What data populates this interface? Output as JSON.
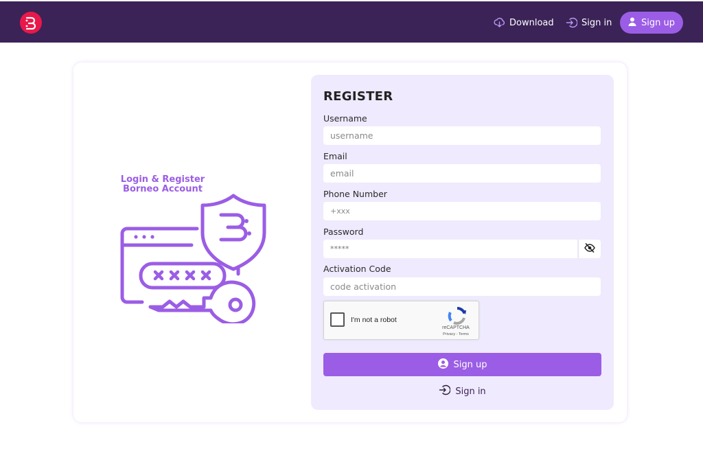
{
  "header": {
    "brand_icon": "borneo-logo-icon",
    "nav": {
      "download_label": "Download",
      "signin_label": "Sign in",
      "signup_label": "Sign up"
    }
  },
  "illustration": {
    "title_line1": "Login & Register",
    "title_line2": "Borneo Account",
    "password_mask": "x x x x"
  },
  "form": {
    "title": "REGISTER",
    "username": {
      "label": "Username",
      "placeholder": "username"
    },
    "email": {
      "label": "Email",
      "placeholder": "email"
    },
    "phone": {
      "label": "Phone Number",
      "placeholder": "+xxx"
    },
    "password": {
      "label": "Password",
      "placeholder": "*****",
      "toggle_icon": "eye-slash-icon"
    },
    "activation": {
      "label": "Activation Code",
      "placeholder": "code activation"
    },
    "captcha": {
      "label": "I'm not a robot",
      "brand": "reCAPTCHA",
      "links": "Privacy - Terms"
    },
    "submit_label": "Sign up",
    "signin_label": "Sign in"
  },
  "colors": {
    "header_bg": "#3b2358",
    "accent": "#9b5de5",
    "panel_bg": "#efeafd",
    "logo_red": "#e8194a"
  }
}
